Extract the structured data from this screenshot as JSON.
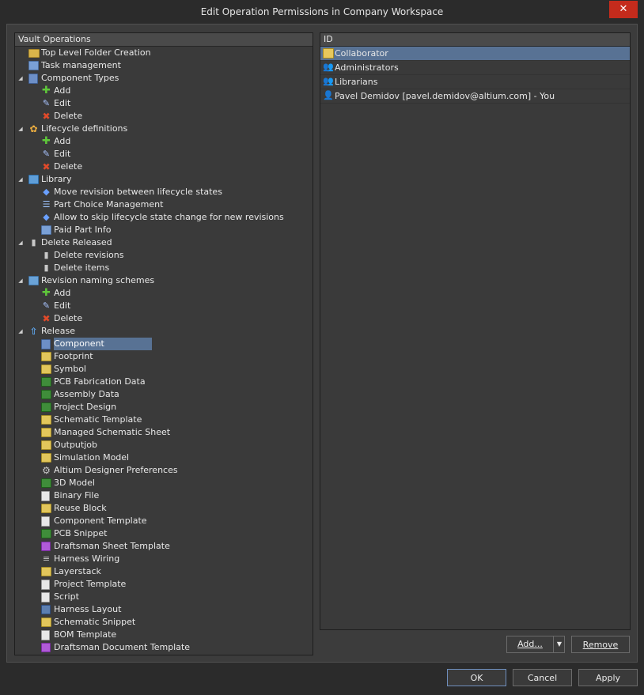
{
  "window": {
    "title": "Edit Operation Permissions in Company Workspace",
    "close_glyph": "✕"
  },
  "left_panel": {
    "header": "Vault Operations",
    "items": [
      {
        "label": "Top Level Folder Creation",
        "level": 0,
        "expander": "",
        "icon": "folder-icon"
      },
      {
        "label": "Task management",
        "level": 0,
        "expander": "",
        "icon": "task-icon"
      },
      {
        "label": "Component Types",
        "level": 0,
        "expander": "◢",
        "icon": "component-types-icon"
      },
      {
        "label": "Add",
        "level": 1,
        "expander": "",
        "icon": "add-icon"
      },
      {
        "label": "Edit",
        "level": 1,
        "expander": "",
        "icon": "edit-icon"
      },
      {
        "label": "Delete",
        "level": 1,
        "expander": "",
        "icon": "delete-icon"
      },
      {
        "label": "Lifecycle definitions",
        "level": 0,
        "expander": "◢",
        "icon": "lifecycle-icon"
      },
      {
        "label": "Add",
        "level": 1,
        "expander": "",
        "icon": "add-icon"
      },
      {
        "label": "Edit",
        "level": 1,
        "expander": "",
        "icon": "edit-icon"
      },
      {
        "label": "Delete",
        "level": 1,
        "expander": "",
        "icon": "delete-icon"
      },
      {
        "label": "Library",
        "level": 0,
        "expander": "◢",
        "icon": "library-icon"
      },
      {
        "label": "Move revision between lifecycle states",
        "level": 1,
        "expander": "",
        "icon": "move-icon"
      },
      {
        "label": "Part Choice Management",
        "level": 1,
        "expander": "",
        "icon": "part-choice-icon"
      },
      {
        "label": "Allow to skip lifecycle state change for new revisions",
        "level": 1,
        "expander": "",
        "icon": "move-icon"
      },
      {
        "label": "Paid Part Info",
        "level": 1,
        "expander": "",
        "icon": "paid-part-icon"
      },
      {
        "label": "Delete Released",
        "level": 0,
        "expander": "◢",
        "icon": "trash-icon"
      },
      {
        "label": "Delete revisions",
        "level": 1,
        "expander": "",
        "icon": "trash-icon"
      },
      {
        "label": "Delete items",
        "level": 1,
        "expander": "",
        "icon": "trash-icon"
      },
      {
        "label": "Revision naming schemes",
        "level": 0,
        "expander": "◢",
        "icon": "naming-icon"
      },
      {
        "label": "Add",
        "level": 1,
        "expander": "",
        "icon": "add-icon"
      },
      {
        "label": "Edit",
        "level": 1,
        "expander": "",
        "icon": "edit-icon"
      },
      {
        "label": "Delete",
        "level": 1,
        "expander": "",
        "icon": "delete-icon"
      },
      {
        "label": "Release",
        "level": 0,
        "expander": "◢",
        "icon": "release-icon"
      },
      {
        "label": "Component",
        "level": 1,
        "expander": "",
        "icon": "component-icon",
        "selected": true
      },
      {
        "label": "Footprint",
        "level": 1,
        "expander": "",
        "icon": "footprint-icon"
      },
      {
        "label": "Symbol",
        "level": 1,
        "expander": "",
        "icon": "symbol-icon"
      },
      {
        "label": "PCB Fabrication Data",
        "level": 1,
        "expander": "",
        "icon": "pcb-fab-icon"
      },
      {
        "label": "Assembly Data",
        "level": 1,
        "expander": "",
        "icon": "assembly-icon"
      },
      {
        "label": "Project Design",
        "level": 1,
        "expander": "",
        "icon": "project-design-icon"
      },
      {
        "label": "Schematic Template",
        "level": 1,
        "expander": "",
        "icon": "schematic-template-icon"
      },
      {
        "label": "Managed Schematic Sheet",
        "level": 1,
        "expander": "",
        "icon": "schematic-sheet-icon"
      },
      {
        "label": "Outputjob",
        "level": 1,
        "expander": "",
        "icon": "outputjob-icon"
      },
      {
        "label": "Simulation Model",
        "level": 1,
        "expander": "",
        "icon": "simulation-icon"
      },
      {
        "label": "Altium Designer Preferences",
        "level": 1,
        "expander": "",
        "icon": "gear-icon"
      },
      {
        "label": "3D Model",
        "level": 1,
        "expander": "",
        "icon": "3d-model-icon"
      },
      {
        "label": "Binary File",
        "level": 1,
        "expander": "",
        "icon": "binary-file-icon"
      },
      {
        "label": "Reuse Block",
        "level": 1,
        "expander": "",
        "icon": "reuse-block-icon"
      },
      {
        "label": "Component Template",
        "level": 1,
        "expander": "",
        "icon": "component-template-icon"
      },
      {
        "label": "PCB Snippet",
        "level": 1,
        "expander": "",
        "icon": "pcb-snippet-icon"
      },
      {
        "label": "Draftsman Sheet Template",
        "level": 1,
        "expander": "",
        "icon": "draftsman-sheet-icon"
      },
      {
        "label": "Harness Wiring",
        "level": 1,
        "expander": "",
        "icon": "harness-wiring-icon"
      },
      {
        "label": "Layerstack",
        "level": 1,
        "expander": "",
        "icon": "layerstack-icon"
      },
      {
        "label": "Project Template",
        "level": 1,
        "expander": "",
        "icon": "project-template-icon"
      },
      {
        "label": "Script",
        "level": 1,
        "expander": "",
        "icon": "script-icon"
      },
      {
        "label": "Harness Layout",
        "level": 1,
        "expander": "",
        "icon": "harness-layout-icon"
      },
      {
        "label": "Schematic Snippet",
        "level": 1,
        "expander": "",
        "icon": "schematic-snippet-icon"
      },
      {
        "label": "BOM Template",
        "level": 1,
        "expander": "",
        "icon": "bom-template-icon"
      },
      {
        "label": "Draftsman Document Template",
        "level": 1,
        "expander": "",
        "icon": "draftsman-document-icon"
      }
    ]
  },
  "right_panel": {
    "header": "ID",
    "rows": [
      {
        "label": "Collaborator",
        "icon": "collaborator-icon",
        "selected": true
      },
      {
        "label": "Administrators",
        "icon": "group-icon"
      },
      {
        "label": "Librarians",
        "icon": "group-icon"
      },
      {
        "label": "Pavel Demidov [pavel.demidov@altium.com] - You",
        "icon": "user-icon"
      }
    ]
  },
  "buttons": {
    "add": "Add...",
    "add_arrow": "▼",
    "remove": "Remove",
    "ok": "OK",
    "cancel": "Cancel",
    "apply": "Apply"
  }
}
